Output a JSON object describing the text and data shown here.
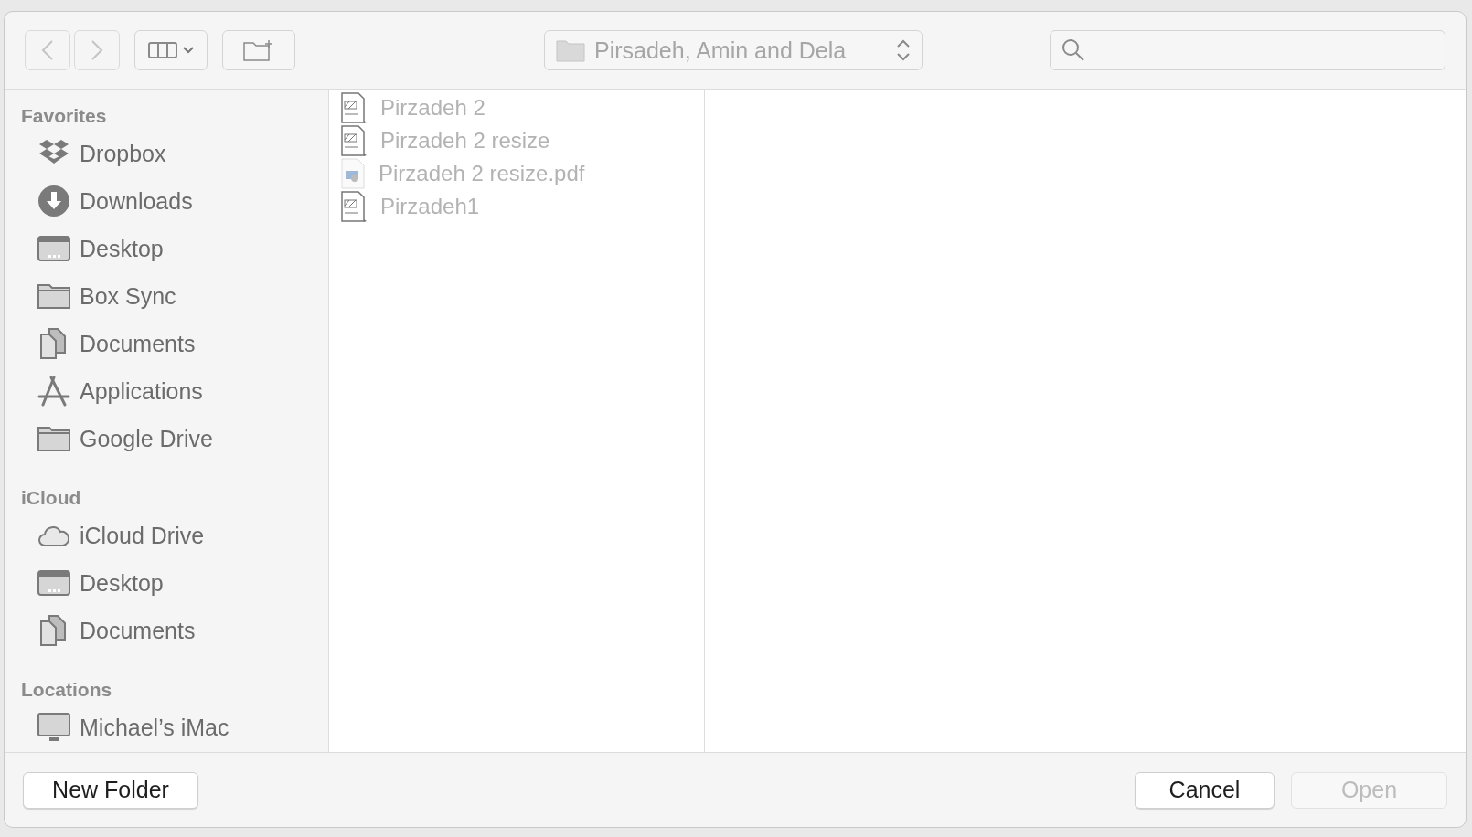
{
  "toolbar": {
    "back": {
      "disabled": true
    },
    "forward": {
      "disabled": true
    },
    "path": {
      "label": "Pirsadeh, Amin and Dela"
    }
  },
  "sidebar": {
    "sections": [
      {
        "title": "Favorites",
        "items": [
          {
            "label": "Dropbox",
            "kind": "dropbox"
          },
          {
            "label": "Downloads",
            "kind": "download"
          },
          {
            "label": "Desktop",
            "kind": "desktop"
          },
          {
            "label": "Box Sync",
            "kind": "folder"
          },
          {
            "label": "Documents",
            "kind": "documents"
          },
          {
            "label": "Applications",
            "kind": "applications"
          },
          {
            "label": "Google Drive",
            "kind": "folder"
          }
        ]
      },
      {
        "title": "iCloud",
        "items": [
          {
            "label": "iCloud Drive",
            "kind": "cloud"
          },
          {
            "label": "Desktop",
            "kind": "desktop"
          },
          {
            "label": "Documents",
            "kind": "documents"
          }
        ]
      },
      {
        "title": "Locations",
        "items": [
          {
            "label": "Michael’s iMac",
            "kind": "imac"
          }
        ]
      }
    ]
  },
  "files": [
    {
      "name": "Pirzadeh 2",
      "kind": "drawing",
      "disabled": true
    },
    {
      "name": "Pirzadeh 2 resize",
      "kind": "drawing",
      "disabled": true
    },
    {
      "name": "Pirzadeh 2 resize.pdf",
      "kind": "pdf",
      "disabled": true
    },
    {
      "name": "Pirzadeh1",
      "kind": "drawing",
      "disabled": true
    }
  ],
  "buttons": {
    "new_folder": {
      "label": "New Folder",
      "disabled": false
    },
    "cancel": {
      "label": "Cancel",
      "disabled": false
    },
    "open": {
      "label": "Open",
      "disabled": true
    }
  }
}
